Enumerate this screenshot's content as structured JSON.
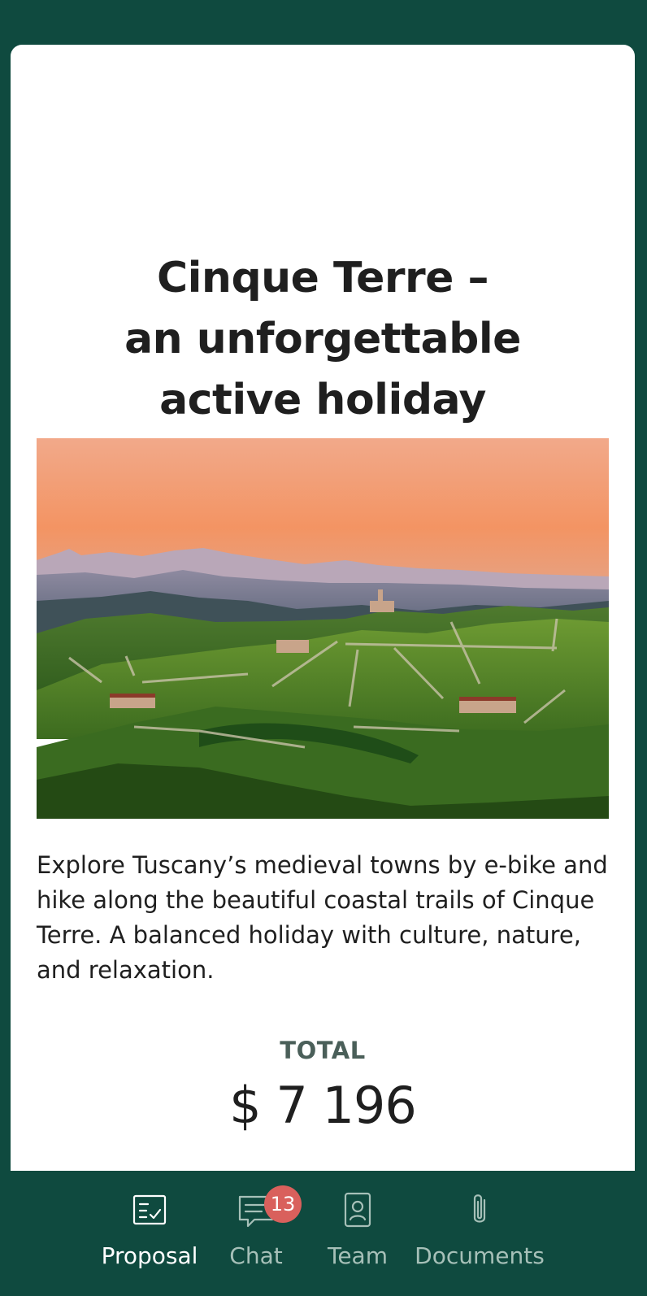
{
  "proposal": {
    "title_lines": [
      "Cinque Terre –",
      "an unforgettable",
      "active holiday"
    ],
    "description": "Explore Tuscany’s medieval towns by e-bike and hike along the beautiful coastal trails of Cinque Terre. A balanced holiday with culture, nature, and relaxation.",
    "total_label": "TOTAL",
    "total_value": "$ 7 196"
  },
  "nav": {
    "items": [
      {
        "label": "Proposal",
        "icon": "proposal-checklist-icon",
        "active": true
      },
      {
        "label": "Chat",
        "icon": "chat-icon",
        "badge": "13"
      },
      {
        "label": "Team",
        "icon": "team-contact-icon"
      },
      {
        "label": "Documents",
        "icon": "paperclip-icon"
      }
    ]
  },
  "colors": {
    "background": "#0f4a3f",
    "card": "#ffffff",
    "badge": "#d9605c",
    "nav_inactive": "#a6c0b8",
    "nav_active": "#ffffff"
  }
}
